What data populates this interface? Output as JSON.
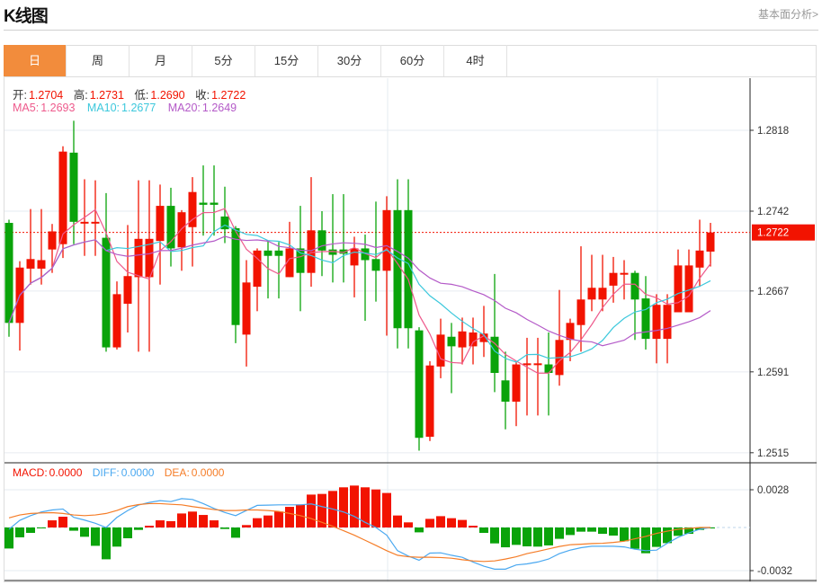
{
  "header": {
    "title": "K线图",
    "link": "基本面分析>"
  },
  "tabs": [
    {
      "label": "日",
      "active": true
    },
    {
      "label": "周"
    },
    {
      "label": "月"
    },
    {
      "label": "5分"
    },
    {
      "label": "15分"
    },
    {
      "label": "30分"
    },
    {
      "label": "60分"
    },
    {
      "label": "4时"
    }
  ],
  "ohlc_info": {
    "open_label": "开:",
    "open": "1.2704",
    "high_label": "高:",
    "high": "1.2731",
    "low_label": "低:",
    "low": "1.2690",
    "close_label": "收:",
    "close": "1.2722"
  },
  "ma_info": {
    "ma5_label": "MA5:",
    "ma5": "1.2693",
    "ma10_label": "MA10:",
    "ma10": "1.2677",
    "ma20_label": "MA20:",
    "ma20": "1.2649"
  },
  "macd_info": {
    "macd_label": "MACD:",
    "macd": "0.0000",
    "diff_label": "DIFF:",
    "diff": "0.0000",
    "dea_label": "DEA:",
    "dea": "0.0000"
  },
  "colors": {
    "up": "#f21300",
    "down": "#0aa30a",
    "accent": "#f28c3c",
    "ma5": "#ee5a8c",
    "ma10": "#3cc8dc",
    "ma20": "#b45ac8",
    "diff": "#4aa8f0",
    "dea": "#f57d28"
  },
  "chart_data": {
    "type": "candlestick",
    "price_axis_ticks": [
      "1.2818",
      "1.2742",
      "1.2667",
      "1.2591",
      "1.2515"
    ],
    "price_range": [
      1.2515,
      1.2818
    ],
    "current_price": "1.2722",
    "macd_axis_ticks": [
      "0.0028",
      "-0.0032"
    ],
    "macd_range": [
      -0.0032,
      0.0028
    ],
    "candles": [
      [
        1.2731,
        1.2734,
        1.2624,
        1.2637
      ],
      [
        1.2637,
        1.2695,
        1.2611,
        1.2689
      ],
      [
        1.2688,
        1.2744,
        1.2673,
        1.2697
      ],
      [
        1.2688,
        1.2744,
        1.2673,
        1.2696
      ],
      [
        1.2706,
        1.273,
        1.2684,
        1.2723
      ],
      [
        1.2711,
        1.2803,
        1.2698,
        1.2798
      ],
      [
        1.2797,
        1.2827,
        1.2711,
        1.2732
      ],
      [
        1.2732,
        1.2772,
        1.27,
        1.2732
      ],
      [
        1.2732,
        1.2771,
        1.27,
        1.2732
      ],
      [
        1.2717,
        1.2759,
        1.261,
        1.2614
      ],
      [
        1.2614,
        1.2676,
        1.2612,
        1.2664
      ],
      [
        1.2655,
        1.2729,
        1.2628,
        1.2681
      ],
      [
        1.268,
        1.2771,
        1.261,
        1.2716
      ],
      [
        1.268,
        1.2771,
        1.261,
        1.2716
      ],
      [
        1.2714,
        1.2767,
        1.2673,
        1.2747
      ],
      [
        1.2747,
        1.2764,
        1.269,
        1.2707
      ],
      [
        1.2708,
        1.2743,
        1.2686,
        1.2741
      ],
      [
        1.2727,
        1.2774,
        1.269,
        1.276
      ],
      [
        1.275,
        1.2785,
        1.2719,
        1.2748
      ],
      [
        1.275,
        1.2785,
        1.2719,
        1.2748
      ],
      [
        1.2737,
        1.2765,
        1.2712,
        1.2725
      ],
      [
        1.2726,
        1.2728,
        1.2618,
        1.2635
      ],
      [
        1.2626,
        1.2696,
        1.2596,
        1.2675
      ],
      [
        1.2671,
        1.2707,
        1.2648,
        1.2705
      ],
      [
        1.2705,
        1.2714,
        1.266,
        1.27
      ],
      [
        1.2705,
        1.2713,
        1.266,
        1.27
      ],
      [
        1.268,
        1.2732,
        1.268,
        1.2707
      ],
      [
        1.2707,
        1.2747,
        1.2648,
        1.2684
      ],
      [
        1.2684,
        1.2774,
        1.2671,
        1.2724
      ],
      [
        1.2724,
        1.2742,
        1.2681,
        1.2705
      ],
      [
        1.2706,
        1.2758,
        1.2675,
        1.2701
      ],
      [
        1.2706,
        1.2758,
        1.2675,
        1.2702
      ],
      [
        1.2691,
        1.2718,
        1.2661,
        1.2707
      ],
      [
        1.2707,
        1.272,
        1.2639,
        1.2696
      ],
      [
        1.2697,
        1.2751,
        1.2657,
        1.2686
      ],
      [
        1.2686,
        1.2756,
        1.2625,
        1.2743
      ],
      [
        1.2743,
        1.2772,
        1.2613,
        1.2632
      ],
      [
        1.2743,
        1.2772,
        1.2613,
        1.2632
      ],
      [
        1.263,
        1.2633,
        1.2517,
        1.2529
      ],
      [
        1.253,
        1.2601,
        1.2526,
        1.2597
      ],
      [
        1.2596,
        1.2641,
        1.2585,
        1.2626
      ],
      [
        1.2624,
        1.2637,
        1.2571,
        1.2615
      ],
      [
        1.2614,
        1.2642,
        1.2598,
        1.2629
      ],
      [
        1.2615,
        1.2642,
        1.2598,
        1.2628
      ],
      [
        1.2619,
        1.2653,
        1.2605,
        1.2627
      ],
      [
        1.2624,
        1.2683,
        1.2572,
        1.259
      ],
      [
        1.2583,
        1.261,
        1.2537,
        1.2563
      ],
      [
        1.2563,
        1.26,
        1.254,
        1.2598
      ],
      [
        1.2598,
        1.2623,
        1.255,
        1.2599
      ],
      [
        1.2598,
        1.2623,
        1.255,
        1.2599
      ],
      [
        1.2598,
        1.2628,
        1.255,
        1.259
      ],
      [
        1.2588,
        1.2668,
        1.2578,
        1.2621
      ],
      [
        1.2621,
        1.2641,
        1.2601,
        1.2637
      ],
      [
        1.2635,
        1.2709,
        1.261,
        1.2659
      ],
      [
        1.2659,
        1.2701,
        1.2648,
        1.267
      ],
      [
        1.2659,
        1.2701,
        1.2648,
        1.267
      ],
      [
        1.2672,
        1.2699,
        1.2656,
        1.2684
      ],
      [
        1.2683,
        1.2696,
        1.2659,
        1.2684
      ],
      [
        1.2684,
        1.2686,
        1.2621,
        1.2659
      ],
      [
        1.266,
        1.2681,
        1.2612,
        1.2622
      ],
      [
        1.2622,
        1.2664,
        1.2599,
        1.2654
      ],
      [
        1.2622,
        1.2664,
        1.2599,
        1.2654
      ],
      [
        1.2647,
        1.2706,
        1.2647,
        1.2691
      ],
      [
        1.2647,
        1.2706,
        1.2647,
        1.2691
      ],
      [
        1.2689,
        1.2734,
        1.2671,
        1.2705
      ],
      [
        1.2704,
        1.2731,
        1.269,
        1.2722
      ]
    ],
    "macd_hist": [
      -0.00156,
      -0.00073,
      -0.0004,
      -2e-05,
      0.00053,
      0.0008,
      -0.00024,
      -0.00069,
      -0.00136,
      -0.00236,
      -0.00142,
      -0.0008,
      -0.00018,
      0.00013,
      0.00053,
      0.00047,
      0.00104,
      0.00118,
      0.00093,
      0.00053,
      -0.00011,
      -0.00076,
      0.00018,
      0.00069,
      0.00089,
      0.00118,
      0.00153,
      0.00171,
      0.00244,
      0.00249,
      0.00271,
      0.00298,
      0.00311,
      0.00298,
      0.00282,
      0.00256,
      0.00089,
      0.00038,
      -0.00036,
      0.00064,
      0.00084,
      0.00069,
      0.00056,
      0.00013,
      -0.0004,
      -0.00118,
      -0.00147,
      -0.00129,
      -0.0014,
      -0.00142,
      -0.00133,
      -0.00084,
      -0.00056,
      -0.00031,
      -0.00031,
      -0.00047,
      -0.0006,
      -0.00102,
      -0.00158,
      -0.00191,
      -0.00144,
      -0.00116,
      -0.00062,
      -0.00047,
      -0.00018,
      -7e-05
    ],
    "diff": [
      -0.00013,
      0.00053,
      0.00088,
      0.00115,
      0.0013,
      0.00137,
      0.00075,
      0.00055,
      0.00031,
      0,
      0.00075,
      0.00126,
      0.00166,
      0.00186,
      0.00199,
      0.00192,
      0.00214,
      0.00208,
      0.00177,
      0.00141,
      0.00111,
      0.00088,
      0.00126,
      0.00164,
      0.00166,
      0.00168,
      0.00168,
      0.00168,
      0.00175,
      0.00155,
      0.00137,
      0.00115,
      0.00082,
      0.00038,
      0,
      -0.00057,
      -0.00172,
      -0.00212,
      -0.00243,
      -0.0019,
      -0.00188,
      -0.00206,
      -0.00221,
      -0.00256,
      -0.00287,
      -0.00309,
      -0.00309,
      -0.00278,
      -0.0027,
      -0.00256,
      -0.00234,
      -0.00194,
      -0.00168,
      -0.0015,
      -0.00139,
      -0.00139,
      -0.00139,
      -0.00144,
      -0.00161,
      -0.00172,
      -0.00168,
      -0.00117,
      -0.00073,
      -0.0004,
      -0.00013,
      0
    ],
    "dea": [
      0.00071,
      0.00093,
      0.00104,
      0.00108,
      0.0011,
      0.00104,
      0.00093,
      0.00088,
      0.00093,
      0.00104,
      0.00126,
      0.00155,
      0.0017,
      0.00177,
      0.00177,
      0.00172,
      0.00168,
      0.00155,
      0.00144,
      0.00133,
      0.00126,
      0.00126,
      0.0013,
      0.0013,
      0.00126,
      0.00119,
      0.00104,
      0.00088,
      0.00066,
      0.00038,
      9e-05,
      -0.00024,
      -0.00057,
      -0.00095,
      -0.00133,
      -0.00172,
      -0.00206,
      -0.00217,
      -0.00221,
      -0.00221,
      -0.00223,
      -0.00228,
      -0.00239,
      -0.00248,
      -0.00252,
      -0.00248,
      -0.00234,
      -0.00217,
      -0.00194,
      -0.00177,
      -0.00159,
      -0.00141,
      -0.00128,
      -0.00124,
      -0.00119,
      -0.00117,
      -0.00111,
      -0.00102,
      -0.00084,
      -0.00066,
      -0.00044,
      -0.00027,
      -0.00013,
      -7e-05,
      0,
      0
    ]
  }
}
